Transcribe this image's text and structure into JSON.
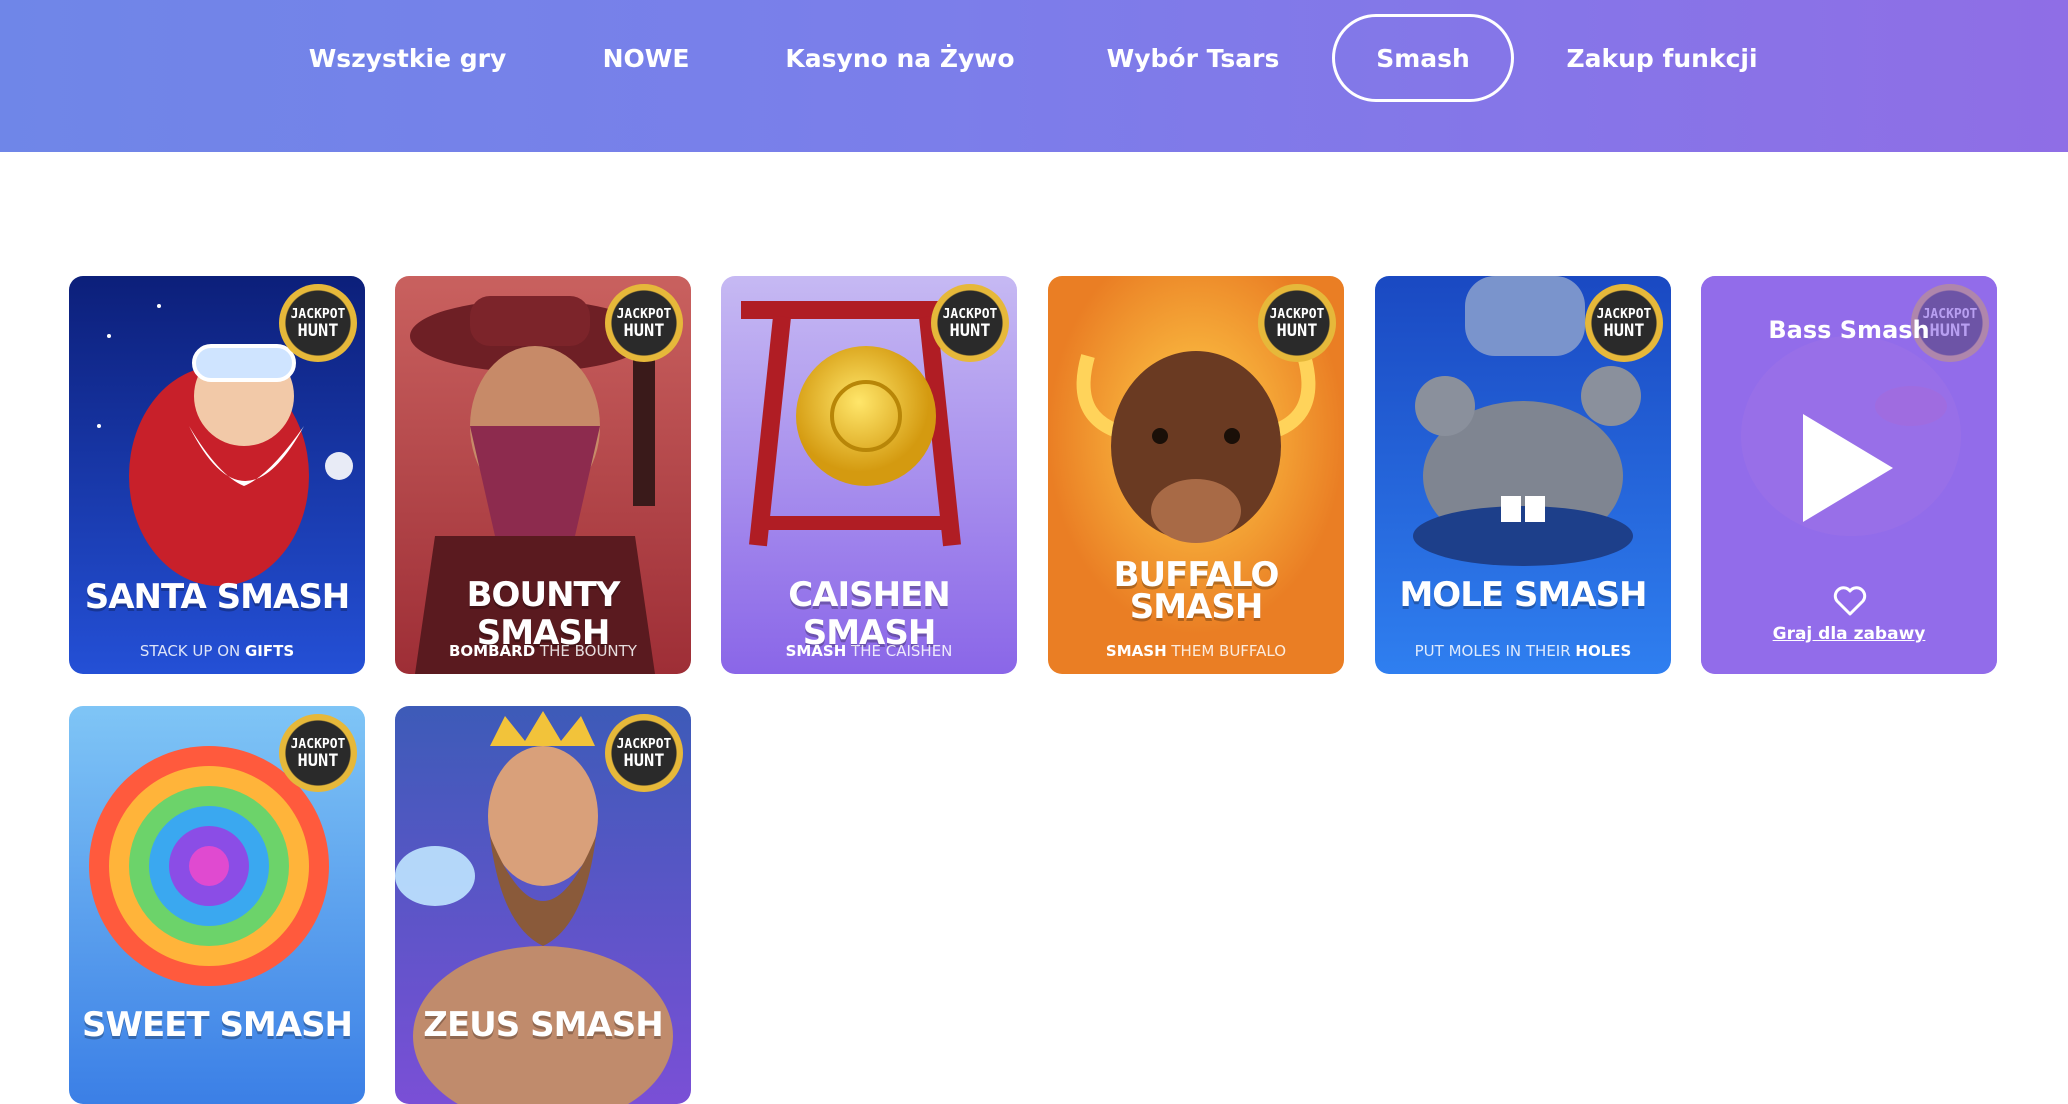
{
  "nav": {
    "tabs": [
      {
        "label": "Wszystkie gry",
        "active": false
      },
      {
        "label": "NOWE",
        "active": false
      },
      {
        "label": "Kasyno na Żywo",
        "active": false
      },
      {
        "label": "Wybór Tsars",
        "active": false
      },
      {
        "label": "Smash",
        "active": true
      },
      {
        "label": "Zakup funkcji",
        "active": false
      }
    ]
  },
  "badge": {
    "line1": "JACKPOT",
    "line2": "HUNT"
  },
  "games": [
    {
      "title": "SANTA SMASH",
      "sub_bold": "",
      "sub_pre": "STACK UP ON ",
      "sub_post": "GIFTS",
      "bg": "#1e3bbd"
    },
    {
      "title": "BOUNTY SMASH",
      "sub_bold": "BOMBARD",
      "sub_pre": "",
      "sub_post": " THE BOUNTY",
      "bg": "#b8454a"
    },
    {
      "title": "CAISHEN SMASH",
      "sub_bold": "SMASH",
      "sub_pre": "",
      "sub_post": " THE CAISHEN",
      "bg": "#8e6ee8"
    },
    {
      "title_line1": "BUFFALO",
      "title_line2": "SMASH",
      "sub_bold": "SMASH",
      "sub_pre": "",
      "sub_post": " THEM BUFFALO",
      "bg": "#ef8f2f"
    },
    {
      "title": "MOLE SMASH",
      "sub_bold": "HOLES",
      "sub_pre": "PUT MOLES IN THEIR ",
      "sub_post": "",
      "bg": "#1f5fd2"
    },
    {
      "hover_title": "Bass Smash",
      "play_label": "Graj dla zabawy",
      "bg": "#8a67e6"
    },
    {
      "title": "SWEET SMASH",
      "bg": "#5aa2ef"
    },
    {
      "title": "ZEUS SMASH",
      "bg": "#6a4fc8"
    }
  ],
  "colors": {
    "accent": "#7b7eea",
    "white": "#ffffff"
  }
}
